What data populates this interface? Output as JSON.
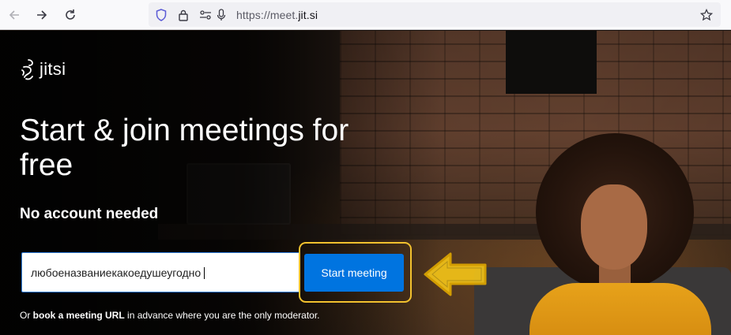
{
  "browser": {
    "url_prefix": "https://meet.",
    "url_domain": "jit.si",
    "icons": [
      "back-icon",
      "forward-icon",
      "reload-icon",
      "shield-icon",
      "lock-icon",
      "permissions-icon",
      "microphone-icon",
      "bookmark-star-icon"
    ]
  },
  "page": {
    "logo_text": "jitsi",
    "headline": "Start & join meetings for free",
    "subheading": "No account needed",
    "room_input_value": "любоеназваниекакоедушеугодно",
    "start_button": "Start meeting",
    "footer": {
      "prefix": "Or ",
      "link": "book a meeting URL",
      "suffix": " in advance where you are the only moderator."
    }
  },
  "colors": {
    "button": "#0074e0",
    "highlight": "#f2c12e",
    "arrow_fill": "#f5c518"
  }
}
